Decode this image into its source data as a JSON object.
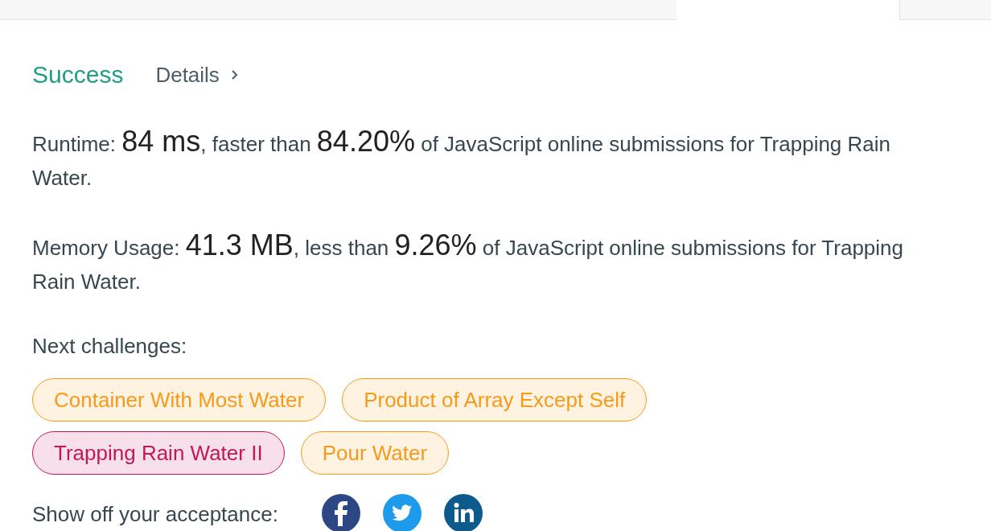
{
  "tabs": [
    {
      "selected": false
    },
    {
      "selected": true
    },
    {
      "selected": false
    }
  ],
  "result": {
    "status": "Success",
    "details_link": "Details"
  },
  "runtime": {
    "label": "Runtime: ",
    "value": "84 ms",
    "middle": ", faster than ",
    "percent": "84.20%",
    "tail": " of JavaScript online submissions for Trapping Rain Water."
  },
  "memory": {
    "label": "Memory Usage: ",
    "value": "41.3 MB",
    "middle": ", less than ",
    "percent": "9.26%",
    "tail": " of JavaScript online submissions for Trapping Rain Water."
  },
  "next_challenges": {
    "label": "Next challenges:",
    "items": [
      {
        "title": "Container With Most Water",
        "color": "#f79a1c"
      },
      {
        "title": "Product of Array Except Self",
        "color": "#f79a1c"
      },
      {
        "title": "Trapping Rain Water II",
        "color": "#c2185b"
      },
      {
        "title": "Pour Water",
        "color": "#f79a1c"
      }
    ]
  },
  "share": {
    "label": "Show off your acceptance:",
    "networks": [
      {
        "kind": "facebook"
      },
      {
        "kind": "twitter"
      },
      {
        "kind": "linkedin"
      }
    ]
  }
}
